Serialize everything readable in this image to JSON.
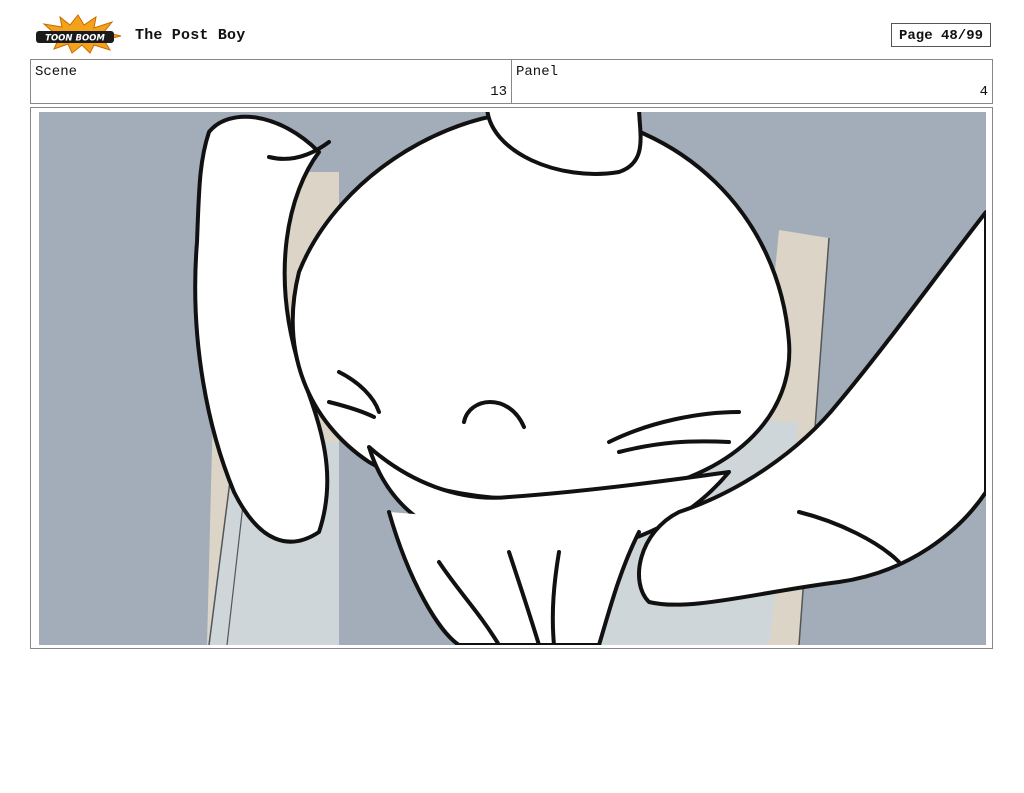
{
  "header": {
    "logo_text": "TOON BOOM",
    "project_title": "The Post Boy",
    "page_label": "Page 48/99"
  },
  "info": {
    "scene_label": "Scene",
    "scene_value": "13",
    "panel_label": "Panel",
    "panel_value": "4"
  },
  "artwork": {
    "subject": "storyboard drawing",
    "colors": {
      "background": "#a2adb9",
      "wall": "#dcd5c7",
      "door": "#cfd6d9",
      "ink": "#111111",
      "fill": "#ffffff"
    }
  }
}
